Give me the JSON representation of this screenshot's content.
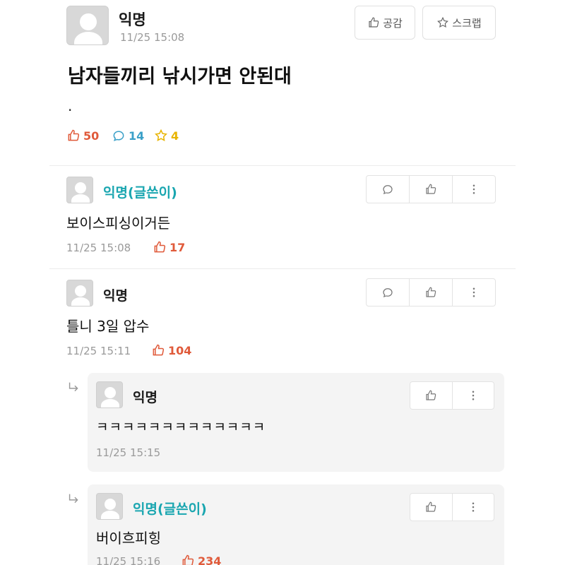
{
  "post": {
    "author": "익명",
    "time": "11/25 15:08",
    "like_button": "공감",
    "scrap_button": "스크랩",
    "title": "남자들끼리 낚시가면 안된대",
    "body": ".",
    "likes": "50",
    "comments": "14",
    "scraps": "4"
  },
  "comments": [
    {
      "author": "익명(글쓴이)",
      "text": "보이스피싱이거든",
      "time": "11/25 15:08",
      "likes": "17"
    },
    {
      "author": "익명",
      "text": "틀니 3일 압수",
      "time": "11/25 15:11",
      "likes": "104"
    }
  ],
  "replies": [
    {
      "author": "익명",
      "text": "ㅋㅋㅋㅋㅋㅋㅋㅋㅋㅋㅋㅋㅋ",
      "time": "11/25 15:15"
    },
    {
      "author": "익명(글쓴이)",
      "text": "버이흐피힝",
      "time": "11/25 15:16",
      "likes": "234"
    }
  ],
  "colors": {
    "like": "#e05a3a",
    "comment": "#3aa0c8",
    "scrap": "#e8b400",
    "author_op": "#1aa6b0"
  }
}
